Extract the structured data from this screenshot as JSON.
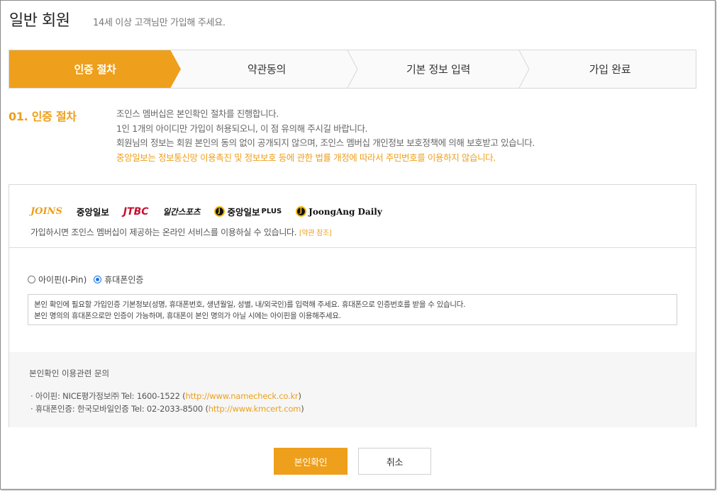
{
  "header": {
    "title": "일반 회원",
    "subtitle": "14세 이상 고객님만 가입해 주세요."
  },
  "steps": [
    {
      "label": "인증 절차",
      "active": true
    },
    {
      "label": "약관동의",
      "active": false
    },
    {
      "label": "기본 정보 입력",
      "active": false
    },
    {
      "label": "가입 완료",
      "active": false
    }
  ],
  "section": {
    "title": "01. 인증 절차",
    "lines": [
      "조인스 멤버십은 본인확인 절차를 진행합니다.",
      "1인 1개의 아이디만 가입이 허용되오니, 이 점 유의해 주시길 바랍니다.",
      "회원님의 정보는 회원 본인의 동의 없이 공개되지 않으며, 조인스 멤버십 개인정보 보호정책에 의해 보호받고 있습니다."
    ],
    "highlight": "중앙일보는 정보통신망 이용촉진 및 정보보호 등에 관한 법률 개정에 따라서 주민번호를 이용하지 않습니다."
  },
  "logos": {
    "joins": "JOINS",
    "joongang": "중앙일보",
    "jtbc": "JTBC",
    "ilgan": "일간스포츠",
    "plus": "중앙일보",
    "plus_suffix": "PLUS",
    "daily": "JoongAng Daily"
  },
  "service": {
    "text": "가입하시면 조인스 멤버십이 제공하는 온라인 서비스를 이용하실 수 있습니다.",
    "terms_link": "[약관 참조]"
  },
  "auth": {
    "options": [
      {
        "label": "아이핀(I-Pin)",
        "selected": false
      },
      {
        "label": "휴대폰인증",
        "selected": true
      }
    ],
    "notice": [
      "본인 확인에 필요할 가입인증 기본정보(성명, 휴대폰번호, 생년월일, 성별, 내/외국인)를 입력해 주세요. 휴대폰으로 인증번호를 받을 수 있습니다.",
      "본인 명의의 휴대폰으로만 인증이 가능하며, 휴대폰이 본인 명의가 아닐 시에는 아이핀을 이용해주세요."
    ]
  },
  "inquiry": {
    "title": "본인확인 이용관련 문의",
    "ipin_text": "· 아이핀: NICE평가정보㈜ Tel: 1600-1522 (",
    "ipin_url": "http://www.namecheck.co.kr",
    "phone_text": "· 휴대폰인증: 한국모바일인증 Tel: 02-2033-8500 (",
    "phone_url": "http://www.kmcert.com",
    "close": ")"
  },
  "buttons": {
    "confirm": "본인확인",
    "cancel": "취소"
  },
  "colors": {
    "accent": "#ee9f1b",
    "radio_selected": "#1a73e8"
  }
}
